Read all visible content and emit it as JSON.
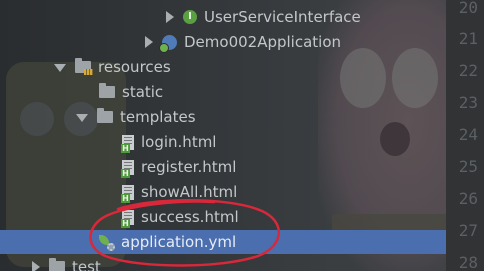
{
  "project_tree": {
    "items": [
      {
        "label": "UserServiceInterface",
        "icon": "interface-icon",
        "expanded": null
      },
      {
        "label": "Demo002Application",
        "icon": "spring-boot-class-icon",
        "expanded": false
      },
      {
        "label": "resources",
        "icon": "resources-folder-icon",
        "expanded": true
      },
      {
        "label": "static",
        "icon": "folder-icon",
        "expanded": null
      },
      {
        "label": "templates",
        "icon": "folder-icon",
        "expanded": true
      },
      {
        "label": "login.html",
        "icon": "html-file-icon",
        "expanded": null
      },
      {
        "label": "register.html",
        "icon": "html-file-icon",
        "expanded": null
      },
      {
        "label": "showAll.html",
        "icon": "html-file-icon",
        "expanded": null
      },
      {
        "label": "success.html",
        "icon": "html-file-icon",
        "expanded": null
      },
      {
        "label": "application.yml",
        "icon": "spring-config-yml-icon",
        "expanded": null,
        "selected": true
      },
      {
        "label": "test",
        "icon": "folder-icon",
        "expanded": false
      }
    ]
  },
  "editor_gutter": {
    "line_numbers": [
      "20",
      "21",
      "22",
      "23",
      "24",
      "25",
      "26",
      "27",
      "28"
    ]
  },
  "colors": {
    "selection": "#4b6eaf",
    "annotation": "#d8283a",
    "text": "#c3c7ca",
    "gutter_text": "#5b6064"
  }
}
